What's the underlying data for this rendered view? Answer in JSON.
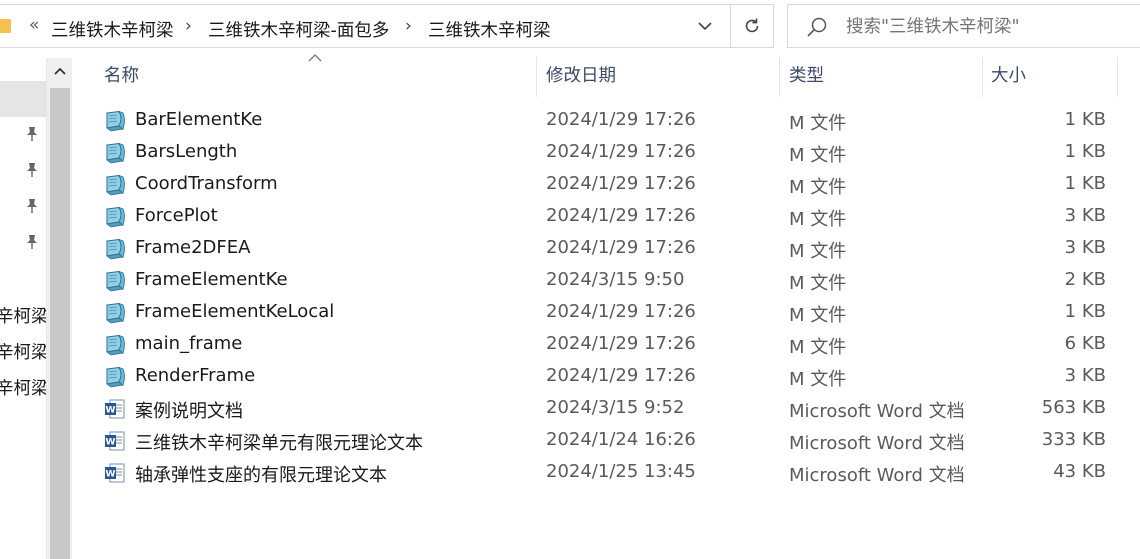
{
  "address": {
    "overflow_glyph": "«",
    "breadcrumbs": [
      "三维铁木辛柯梁",
      "三维铁木辛柯梁-面包多",
      "三维铁木辛柯梁"
    ]
  },
  "search": {
    "placeholder": "搜索\"三维铁木辛柯梁\""
  },
  "nav": {
    "items": [
      "辛柯梁",
      "辛柯梁",
      "辛柯梁"
    ]
  },
  "columns": {
    "name": "名称",
    "modified": "修改日期",
    "type": "类型",
    "size": "大小"
  },
  "files": [
    {
      "name": "BarElementKe",
      "date": "2024/1/29 17:26",
      "type": "M 文件",
      "size": "1 KB",
      "icon": "m-file-icon"
    },
    {
      "name": "BarsLength",
      "date": "2024/1/29 17:26",
      "type": "M 文件",
      "size": "1 KB",
      "icon": "m-file-icon"
    },
    {
      "name": "CoordTransform",
      "date": "2024/1/29 17:26",
      "type": "M 文件",
      "size": "1 KB",
      "icon": "m-file-icon"
    },
    {
      "name": "ForcePlot",
      "date": "2024/1/29 17:26",
      "type": "M 文件",
      "size": "3 KB",
      "icon": "m-file-icon"
    },
    {
      "name": "Frame2DFEA",
      "date": "2024/1/29 17:26",
      "type": "M 文件",
      "size": "3 KB",
      "icon": "m-file-icon"
    },
    {
      "name": "FrameElementKe",
      "date": "2024/3/15 9:50",
      "type": "M 文件",
      "size": "2 KB",
      "icon": "m-file-icon"
    },
    {
      "name": "FrameElementKeLocal",
      "date": "2024/1/29 17:26",
      "type": "M 文件",
      "size": "1 KB",
      "icon": "m-file-icon"
    },
    {
      "name": "main_frame",
      "date": "2024/1/29 17:26",
      "type": "M 文件",
      "size": "6 KB",
      "icon": "m-file-icon"
    },
    {
      "name": "RenderFrame",
      "date": "2024/1/29 17:26",
      "type": "M 文件",
      "size": "3 KB",
      "icon": "m-file-icon"
    },
    {
      "name": "案例说明文档",
      "date": "2024/3/15 9:52",
      "type": "Microsoft Word 文档",
      "size": "563 KB",
      "icon": "word-doc-icon"
    },
    {
      "name": "三维铁木辛柯梁单元有限元理论文本",
      "date": "2024/1/24 16:26",
      "type": "Microsoft Word 文档",
      "size": "333 KB",
      "icon": "word-doc-icon"
    },
    {
      "name": "轴承弹性支座的有限元理论文本",
      "date": "2024/1/25 13:45",
      "type": "Microsoft Word 文档",
      "size": "43 KB",
      "icon": "word-doc-icon"
    }
  ],
  "colors": {
    "header_text": "#3b4a6b",
    "word_blue": "#2b579a",
    "folder": "#f2c14e"
  }
}
